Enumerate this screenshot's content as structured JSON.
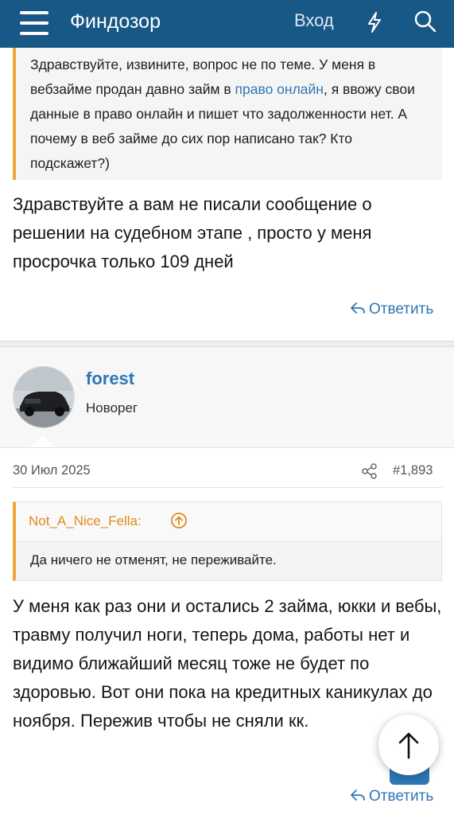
{
  "header": {
    "brand": "Финдозор",
    "login_label": "Вход",
    "icons": [
      "menu-icon",
      "bolt-icon",
      "search-icon"
    ]
  },
  "quote_top": {
    "text_before_link": "Здравствуйте, извините, вопрос не по теме. У меня в вебзайме продан давно займ в ",
    "link": "право онлайн",
    "text_after_link": ", я ввожу свои данные в право онлайн и пишет что задолженности нет. А почему в веб займе до сих пор написано так? Кто подскажет?)"
  },
  "message1": {
    "text": "Здравствуйте а вам не писали сообщение о решении на судебном этапе , просто у меня просрочка только 109 дней",
    "reply_label": "Ответить"
  },
  "post2": {
    "username": "forest",
    "user_title": "Новорег",
    "date": "30 Июл 2025",
    "post_number": "#1,893",
    "quote_author": "Not_A_Nice_Fella:",
    "quote_text": "Да ничего не отменят, не переживайте.",
    "text": "У меня как раз они и остались 2 займа, юкки и вебы, травму получил ноги, теперь дома, работы нет и видимо ближайший месяц тоже не будет по здоровью. Вот они пока на кредитных каникулах до ноября. Пережив чтобы не сняли кк.",
    "reply_label": "Ответить"
  },
  "colors": {
    "header_bg": "#185886",
    "link": "#2f77b5",
    "quote_accent": "#f0a53b"
  }
}
